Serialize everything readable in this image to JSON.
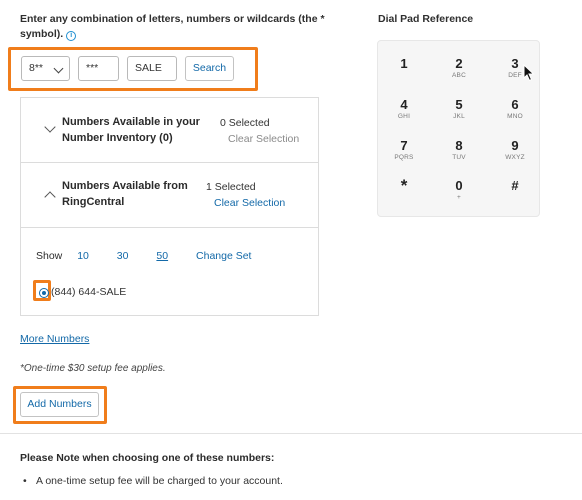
{
  "instructions": {
    "text": "Enter any combination of letters, numbers or wildcards (the * symbol).",
    "info_icon": "info-icon"
  },
  "search": {
    "prefix_value": "8**",
    "middle_value": "***",
    "last_value": "SALE",
    "button_label": "Search"
  },
  "dialpad": {
    "title": "Dial Pad Reference",
    "keys": [
      {
        "num": "1",
        "letters": ""
      },
      {
        "num": "2",
        "letters": "ABC"
      },
      {
        "num": "3",
        "letters": "DEF"
      },
      {
        "num": "4",
        "letters": "GHI"
      },
      {
        "num": "5",
        "letters": "JKL"
      },
      {
        "num": "6",
        "letters": "MNO"
      },
      {
        "num": "7",
        "letters": "PQRS"
      },
      {
        "num": "8",
        "letters": "TUV"
      },
      {
        "num": "9",
        "letters": "WXYZ"
      },
      {
        "num": "*",
        "letters": ""
      },
      {
        "num": "0",
        "letters": "+"
      },
      {
        "num": "#",
        "letters": ""
      }
    ]
  },
  "inventory": {
    "title_line1": "Numbers Available in your",
    "title_line2": "Number Inventory (0)",
    "selected": "0 Selected",
    "clear": "Clear Selection",
    "expanded": false
  },
  "ringcentral": {
    "title_line1": "Numbers Available from",
    "title_line2": "RingCentral",
    "selected": "1 Selected",
    "clear": "Clear Selection",
    "expanded": true
  },
  "show": {
    "label": "Show",
    "options": [
      "10",
      "30",
      "50"
    ],
    "active": "50",
    "change_set": "Change Set"
  },
  "numbers": [
    {
      "label": "(844) 644-SALE",
      "selected": true
    }
  ],
  "more_numbers": "More Numbers",
  "fee_note": "*One-time $30 setup fee applies.",
  "add_button": "Add Numbers",
  "note": {
    "title": "Please Note when choosing one of these numbers:",
    "bullets": [
      "A one-time setup fee will be charged to your account."
    ]
  },
  "colors": {
    "highlight": "#f07d1b",
    "link": "#1369a8"
  }
}
